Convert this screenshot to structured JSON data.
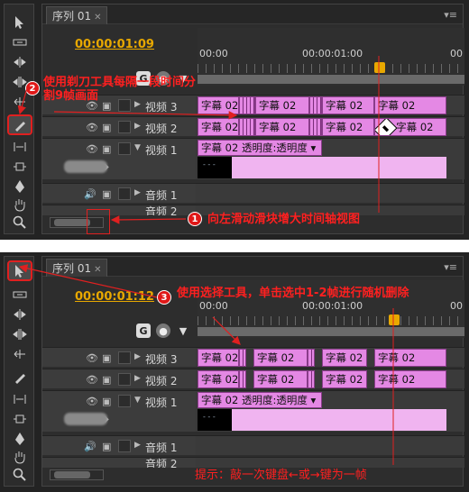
{
  "panel1": {
    "sequence_tab": "序列 01",
    "timecode": "00:00:01:09",
    "ruler_labels": [
      "00:00",
      "00:00:01:00",
      "00"
    ],
    "tracks": {
      "v3": "视频 3",
      "v2": "视频 2",
      "v1": "视频 1",
      "a1": "音频 1",
      "a2": "音频 2"
    },
    "clip_label": "字幕 02",
    "v1_clip_label": "字幕 02 透明度:透明度",
    "annotation_2": "使用剃刀工具每隔一段时间分割9帧画面",
    "annotation_1": "向左滑动滑块增大时间轴视图",
    "badge_1": "1",
    "badge_2": "2"
  },
  "panel2": {
    "sequence_tab": "序列 01",
    "timecode": "00:00:01:12",
    "ruler_labels": [
      "00:00",
      "00:00:01:00",
      "00"
    ],
    "tracks": {
      "v3": "视频 3",
      "v2": "视频 2",
      "v1": "视频 1",
      "a1": "音频 1",
      "a2": "音频 2"
    },
    "clip_label": "字幕 02",
    "v1_clip_label": "字幕 02 透明度:透明度",
    "annotation_3": "使用选择工具，单击选中1-2帧进行随机删除",
    "tip": "提示：敲一次键盘←或→键为一帧",
    "badge_3": "3"
  },
  "icons": [
    "selection-arrow-icon",
    "track-select-icon",
    "ripple-edit-icon",
    "rolling-edit-icon",
    "rate-stretch-icon",
    "razor-icon",
    "slip-icon",
    "slide-icon",
    "pen-icon",
    "hand-icon",
    "zoom-icon"
  ],
  "colors": {
    "timecode": "#e8a800",
    "clip": "#e488e4",
    "annotation": "#e02020",
    "panel": "#232323"
  }
}
